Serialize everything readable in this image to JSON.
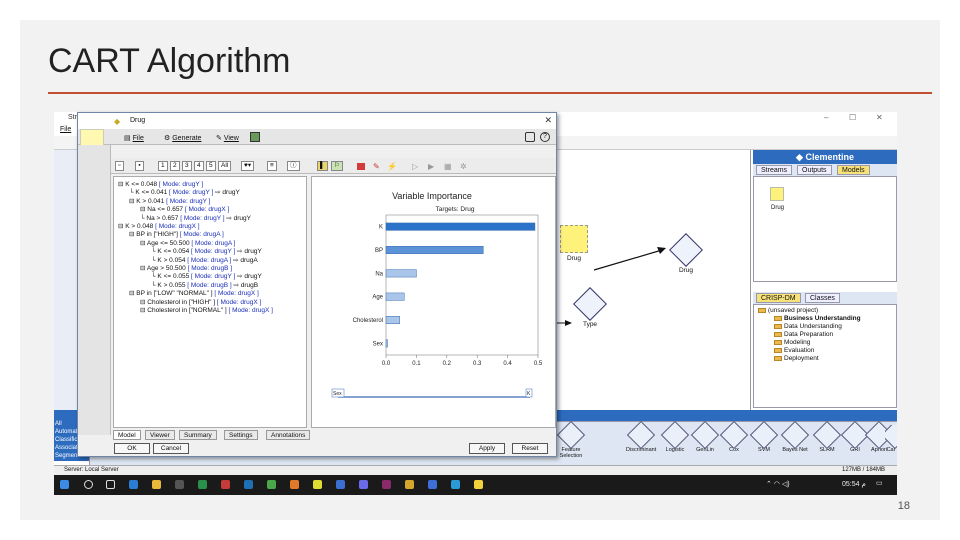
{
  "slide": {
    "title": "CART Algorithm",
    "page_number": "18"
  },
  "app": {
    "window_title": "Stream",
    "menu": [
      "File",
      "E"
    ],
    "clementine_label": "Clementine",
    "manager_tabs": [
      "Streams",
      "Outputs",
      "Models"
    ],
    "model_icon_label": "Drug",
    "crisp_tabs": [
      "CRISP-DM",
      "Classes"
    ],
    "crisp_tree": [
      "(unsaved project)",
      "Business Understanding",
      "Data Understanding",
      "Data Preparation",
      "Modeling",
      "Evaluation",
      "Deployment"
    ],
    "stream_nodes": {
      "drug_model": "Drug",
      "drug_cart": "Drug",
      "type": "Type"
    },
    "palette_list": [
      "All",
      "AutomateD",
      "Classificati",
      "Associatio",
      "Segmentation"
    ],
    "palette_labels": [
      "Feature Selection",
      "Discriminant",
      "Logistic",
      "GenLin",
      "Cox",
      "SVM",
      "Bayes Net",
      "SLRM",
      "GRI",
      "Apriori",
      "Car"
    ],
    "status_server": "Server: Local Server",
    "status_memory": "127MB / 184MB",
    "taskbar_time": "05:54 م"
  },
  "dialog": {
    "title": "Drug",
    "menu": {
      "file": "File",
      "generate": "Generate",
      "view": "View"
    },
    "depth_buttons": [
      "1",
      "2",
      "3",
      "4",
      "5",
      "All"
    ],
    "tree": [
      {
        "indent": 0,
        "text": "K <= 0.048",
        "mode": "[ Mode: drugY ]",
        "arrow": ""
      },
      {
        "indent": 1,
        "text": "K <= 0.041",
        "mode": "[ Mode: drugY ]",
        "arrow": "drugY"
      },
      {
        "indent": 1,
        "text": "K > 0.041",
        "mode": "[ Mode: drugY ]",
        "arrow": ""
      },
      {
        "indent": 2,
        "text": "Na <= 0.657",
        "mode": "[ Mode: drugX ]",
        "arrow": ""
      },
      {
        "indent": 2,
        "text": "Na > 0.657",
        "mode": "[ Mode: drugY ]",
        "arrow": "drugY"
      },
      {
        "indent": 0,
        "text": "K > 0.048",
        "mode": "[ Mode: drugX ]",
        "arrow": ""
      },
      {
        "indent": 1,
        "text": "BP in [\"HIGH\"]",
        "mode": "[ Mode: drugA ]",
        "arrow": ""
      },
      {
        "indent": 2,
        "text": "Age <= 50.500",
        "mode": "[ Mode: drugA ]",
        "arrow": ""
      },
      {
        "indent": 3,
        "text": "K <= 0.054",
        "mode": "[ Mode: drugY ]",
        "arrow": "drugY"
      },
      {
        "indent": 3,
        "text": "K > 0.054",
        "mode": "[ Mode: drugA ]",
        "arrow": "drugA"
      },
      {
        "indent": 2,
        "text": "Age > 50.500",
        "mode": "[ Mode: drugB ]",
        "arrow": ""
      },
      {
        "indent": 3,
        "text": "K <= 0.055",
        "mode": "[ Mode: drugY ]",
        "arrow": "drugY"
      },
      {
        "indent": 3,
        "text": "K > 0.055",
        "mode": "[ Mode: drugB ]",
        "arrow": "drugB"
      },
      {
        "indent": 1,
        "text": "BP in [\"LOW\" \"NORMAL\" ]",
        "mode": "[ Mode: drugX ]",
        "arrow": ""
      },
      {
        "indent": 2,
        "text": "Cholesterol in [\"HIGH\" ]",
        "mode": "[ Mode: drugX ]",
        "arrow": ""
      },
      {
        "indent": 2,
        "text": "Cholesterol in [\"NORMAL\" ]",
        "mode": "[ Mode: drugX ]",
        "arrow": ""
      }
    ],
    "tabs": [
      "Model",
      "Viewer",
      "Summary",
      "Settings",
      "Annotations"
    ],
    "buttons": {
      "ok": "OK",
      "cancel": "Cancel",
      "apply": "Apply",
      "reset": "Reset"
    },
    "slider": {
      "min_label": "Sex",
      "max_label": "K"
    }
  },
  "chart_data": {
    "type": "bar",
    "orientation": "horizontal",
    "title": "Variable Importance",
    "subtitle": "Targets: Drug",
    "categories": [
      "K",
      "BP",
      "Na",
      "Age",
      "Cholesterol",
      "Sex"
    ],
    "values": [
      0.49,
      0.32,
      0.1,
      0.06,
      0.045,
      0.005
    ],
    "xlim": [
      0.0,
      0.5
    ],
    "xticks": [
      "0.0",
      "0.1",
      "0.2",
      "0.3",
      "0.4",
      "0.5"
    ],
    "colors": [
      "#2b73c9",
      "#5b93d6",
      "#a9c6ea",
      "#a9c6ea",
      "#a9c6ea",
      "#a9c6ea"
    ]
  }
}
